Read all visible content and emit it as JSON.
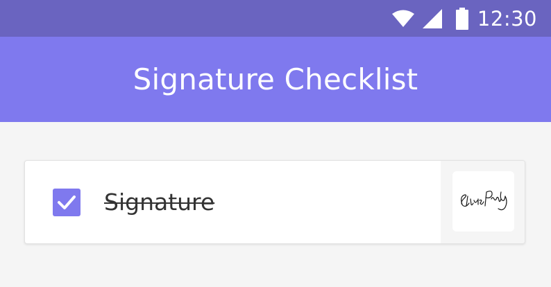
{
  "status_bar": {
    "time": "12:30",
    "icons": [
      "wifi-icon",
      "cellular-signal-icon",
      "battery-icon"
    ],
    "background": "#6a64c0"
  },
  "app_bar": {
    "title": "Signature Checklist",
    "background": "#7f79ee"
  },
  "checklist": {
    "items": [
      {
        "label": "Signature",
        "checked": true,
        "strikethrough": true,
        "thumbnail": "signature-image",
        "thumbnail_text": "Elvis Presley"
      }
    ]
  },
  "colors": {
    "accent": "#7f79ee",
    "page_background": "#f5f5f5"
  }
}
